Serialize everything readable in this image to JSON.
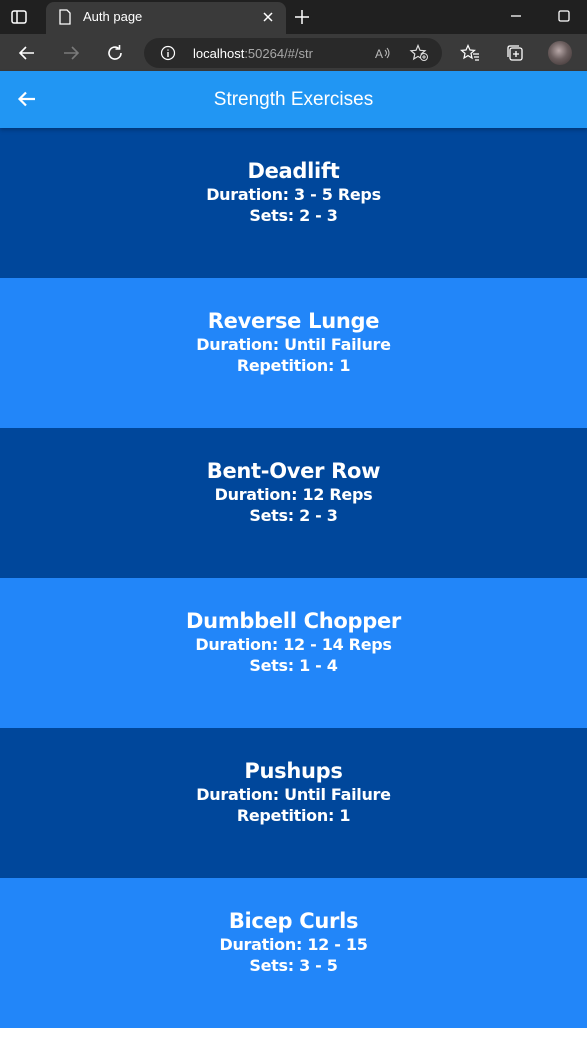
{
  "browser": {
    "tab_title": "Auth page",
    "url_host": "localhost",
    "url_rest": ":50264/#/str"
  },
  "appbar": {
    "title": "Strength Exercises"
  },
  "exercises": [
    {
      "name": "Deadlift",
      "line1": "Duration: 3 - 5 Reps",
      "line2": "Sets: 2 - 3"
    },
    {
      "name": "Reverse Lunge",
      "line1": "Duration: Until Failure",
      "line2": "Repetition: 1"
    },
    {
      "name": "Bent-Over Row",
      "line1": "Duration: 12 Reps",
      "line2": "Sets: 2 - 3"
    },
    {
      "name": "Dumbbell Chopper",
      "line1": "Duration: 12 - 14 Reps",
      "line2": "Sets: 1 - 4"
    },
    {
      "name": "Pushups",
      "line1": "Duration: Until Failure",
      "line2": "Repetition: 1"
    },
    {
      "name": "Bicep Curls",
      "line1": "Duration: 12 - 15",
      "line2": "Sets: 3 - 5"
    }
  ],
  "colors": {
    "appbar": "#2196f3",
    "card_dark": "#00479b",
    "card_light": "#2286f9"
  }
}
